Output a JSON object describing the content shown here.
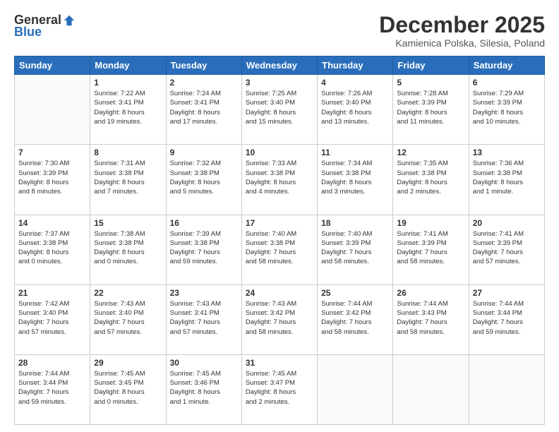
{
  "logo": {
    "general": "General",
    "blue": "Blue"
  },
  "header": {
    "month": "December 2025",
    "location": "Kamienica Polska, Silesia, Poland"
  },
  "weekdays": [
    "Sunday",
    "Monday",
    "Tuesday",
    "Wednesday",
    "Thursday",
    "Friday",
    "Saturday"
  ],
  "weeks": [
    [
      {
        "day": "",
        "info": ""
      },
      {
        "day": "1",
        "info": "Sunrise: 7:22 AM\nSunset: 3:41 PM\nDaylight: 8 hours\nand 19 minutes."
      },
      {
        "day": "2",
        "info": "Sunrise: 7:24 AM\nSunset: 3:41 PM\nDaylight: 8 hours\nand 17 minutes."
      },
      {
        "day": "3",
        "info": "Sunrise: 7:25 AM\nSunset: 3:40 PM\nDaylight: 8 hours\nand 15 minutes."
      },
      {
        "day": "4",
        "info": "Sunrise: 7:26 AM\nSunset: 3:40 PM\nDaylight: 8 hours\nand 13 minutes."
      },
      {
        "day": "5",
        "info": "Sunrise: 7:28 AM\nSunset: 3:39 PM\nDaylight: 8 hours\nand 11 minutes."
      },
      {
        "day": "6",
        "info": "Sunrise: 7:29 AM\nSunset: 3:39 PM\nDaylight: 8 hours\nand 10 minutes."
      }
    ],
    [
      {
        "day": "7",
        "info": "Sunrise: 7:30 AM\nSunset: 3:39 PM\nDaylight: 8 hours\nand 8 minutes."
      },
      {
        "day": "8",
        "info": "Sunrise: 7:31 AM\nSunset: 3:38 PM\nDaylight: 8 hours\nand 7 minutes."
      },
      {
        "day": "9",
        "info": "Sunrise: 7:32 AM\nSunset: 3:38 PM\nDaylight: 8 hours\nand 5 minutes."
      },
      {
        "day": "10",
        "info": "Sunrise: 7:33 AM\nSunset: 3:38 PM\nDaylight: 8 hours\nand 4 minutes."
      },
      {
        "day": "11",
        "info": "Sunrise: 7:34 AM\nSunset: 3:38 PM\nDaylight: 8 hours\nand 3 minutes."
      },
      {
        "day": "12",
        "info": "Sunrise: 7:35 AM\nSunset: 3:38 PM\nDaylight: 8 hours\nand 2 minutes."
      },
      {
        "day": "13",
        "info": "Sunrise: 7:36 AM\nSunset: 3:38 PM\nDaylight: 8 hours\nand 1 minute."
      }
    ],
    [
      {
        "day": "14",
        "info": "Sunrise: 7:37 AM\nSunset: 3:38 PM\nDaylight: 8 hours\nand 0 minutes."
      },
      {
        "day": "15",
        "info": "Sunrise: 7:38 AM\nSunset: 3:38 PM\nDaylight: 8 hours\nand 0 minutes."
      },
      {
        "day": "16",
        "info": "Sunrise: 7:39 AM\nSunset: 3:38 PM\nDaylight: 7 hours\nand 59 minutes."
      },
      {
        "day": "17",
        "info": "Sunrise: 7:40 AM\nSunset: 3:38 PM\nDaylight: 7 hours\nand 58 minutes."
      },
      {
        "day": "18",
        "info": "Sunrise: 7:40 AM\nSunset: 3:39 PM\nDaylight: 7 hours\nand 58 minutes."
      },
      {
        "day": "19",
        "info": "Sunrise: 7:41 AM\nSunset: 3:39 PM\nDaylight: 7 hours\nand 58 minutes."
      },
      {
        "day": "20",
        "info": "Sunrise: 7:41 AM\nSunset: 3:39 PM\nDaylight: 7 hours\nand 57 minutes."
      }
    ],
    [
      {
        "day": "21",
        "info": "Sunrise: 7:42 AM\nSunset: 3:40 PM\nDaylight: 7 hours\nand 57 minutes."
      },
      {
        "day": "22",
        "info": "Sunrise: 7:43 AM\nSunset: 3:40 PM\nDaylight: 7 hours\nand 57 minutes."
      },
      {
        "day": "23",
        "info": "Sunrise: 7:43 AM\nSunset: 3:41 PM\nDaylight: 7 hours\nand 57 minutes."
      },
      {
        "day": "24",
        "info": "Sunrise: 7:43 AM\nSunset: 3:42 PM\nDaylight: 7 hours\nand 58 minutes."
      },
      {
        "day": "25",
        "info": "Sunrise: 7:44 AM\nSunset: 3:42 PM\nDaylight: 7 hours\nand 58 minutes."
      },
      {
        "day": "26",
        "info": "Sunrise: 7:44 AM\nSunset: 3:43 PM\nDaylight: 7 hours\nand 58 minutes."
      },
      {
        "day": "27",
        "info": "Sunrise: 7:44 AM\nSunset: 3:44 PM\nDaylight: 7 hours\nand 59 minutes."
      }
    ],
    [
      {
        "day": "28",
        "info": "Sunrise: 7:44 AM\nSunset: 3:44 PM\nDaylight: 7 hours\nand 59 minutes."
      },
      {
        "day": "29",
        "info": "Sunrise: 7:45 AM\nSunset: 3:45 PM\nDaylight: 8 hours\nand 0 minutes."
      },
      {
        "day": "30",
        "info": "Sunrise: 7:45 AM\nSunset: 3:46 PM\nDaylight: 8 hours\nand 1 minute."
      },
      {
        "day": "31",
        "info": "Sunrise: 7:45 AM\nSunset: 3:47 PM\nDaylight: 8 hours\nand 2 minutes."
      },
      {
        "day": "",
        "info": ""
      },
      {
        "day": "",
        "info": ""
      },
      {
        "day": "",
        "info": ""
      }
    ]
  ]
}
